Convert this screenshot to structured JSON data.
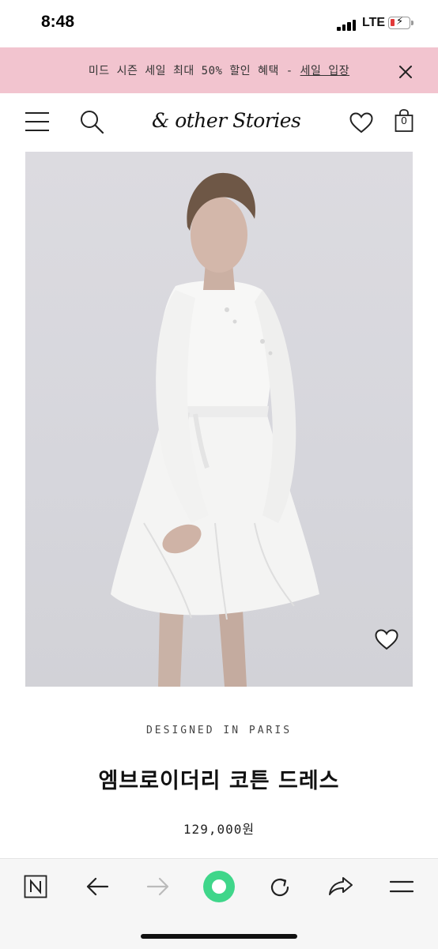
{
  "status_bar": {
    "time": "8:48",
    "network": "LTE"
  },
  "promo": {
    "text": "미드 시즌 세일 최대 50% 할인 혜택 - ",
    "link": "세일 입장"
  },
  "header": {
    "logo": "& other Stories",
    "bag_count": "0"
  },
  "product": {
    "label": "DESIGNED IN PARIS",
    "name": "엠브로이더리 코튼 드레스",
    "price": "129,000원"
  },
  "icons": {
    "menu": "menu-icon",
    "search": "search-icon",
    "wishlist": "heart-icon",
    "bag": "bag-icon",
    "close": "close-icon",
    "back": "back-arrow-icon",
    "forward": "forward-arrow-icon",
    "home": "green-circle-icon",
    "reload": "reload-icon",
    "share": "share-icon",
    "browser_menu": "hamburger-icon"
  },
  "colors": {
    "promo_bg": "#f2c4cf",
    "accent_green": "#3fd68a"
  }
}
